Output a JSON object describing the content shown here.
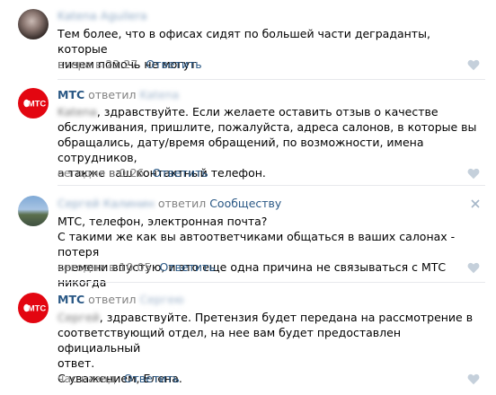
{
  "comments": [
    {
      "author": "Katena Aguilera",
      "replied": "",
      "recipient": "",
      "text_lines": [
        "Тем более, что в офисах сидят по большей части деграданты, которые",
        "ничем помочь не могут"
      ],
      "time": "вчера в 23:27",
      "reply_label": "Ответить"
    },
    {
      "author": "МТС",
      "replied": "ответил",
      "recipient": "Katena",
      "greeting_name": "Katena",
      "text_lines": [
        ", здравствуйте. Если желаете оставить отзыв о качестве",
        "обслуживания, пришлите, пожалуйста, адреса салонов, в которые вы",
        "обращались, дату/время обращений, по возможности, имена сотрудников,",
        "а также ваш контактный телефон."
      ],
      "time": "сегодня в 0:26",
      "reply_label": "Ответить"
    },
    {
      "author": "Сергей Калинин",
      "replied": "ответил",
      "recipient": "Сообществу",
      "text_lines": [
        "МТС, телефон, электронная почта?",
        "С такими же как вы автоответчиками общаться в ваших салонах - потеря",
        "времени впустую, и это еще одна причина не связываться с МТС никогда"
      ],
      "time": "сегодня в 10:05",
      "reply_label": "Ответить"
    },
    {
      "author": "МТС",
      "replied": "ответил",
      "recipient": "Сергею",
      "greeting_name": "Сергей",
      "text_lines": [
        ", здравствуйте. Претензия будет передана на рассмотрение в",
        "соответствующий отдел, на нее вам будет предоставлен официальный",
        "ответ.",
        "С уважением, Елена."
      ],
      "time": "час назад",
      "reply_label": "Ответить"
    }
  ],
  "logo_text": "МТС",
  "colors": {
    "link": "#2a5885",
    "meta": "#828282",
    "mts_red": "#e30611",
    "separator": "#e7e8ec"
  },
  "icons": [
    "heart-icon",
    "close-icon",
    "mts-egg-icon"
  ]
}
